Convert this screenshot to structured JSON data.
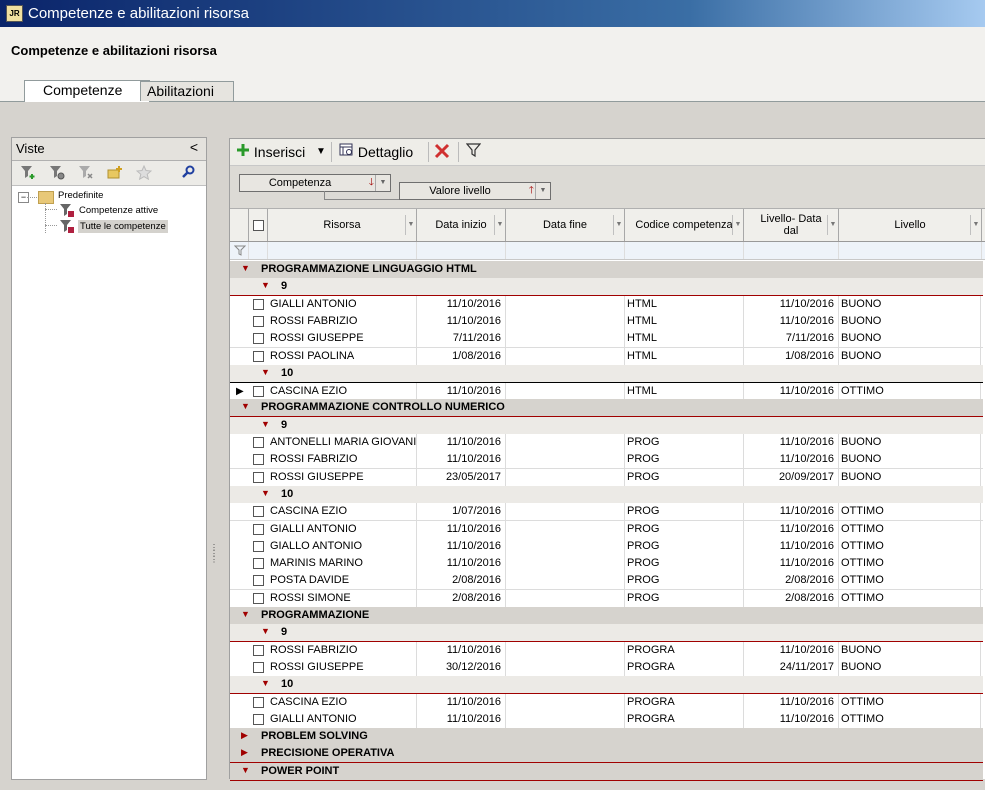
{
  "window": {
    "title": "Competenze e abilitazioni risorsa",
    "app_icon": "jr-app-icon"
  },
  "header": {
    "title": "Competenze e abilitazioni risorsa"
  },
  "tabs": [
    {
      "label": "Competenze",
      "active": true
    },
    {
      "label": "Abilitazioni",
      "active": false
    }
  ],
  "viste": {
    "title": "Viste",
    "collapse_glyph": "<",
    "tree": {
      "root": "Predefinite",
      "items": [
        "Competenze attive",
        "Tutte le competenze"
      ],
      "selected": "Tutte le competenze"
    }
  },
  "toolbar": {
    "insert_label": "Inserisci",
    "detail_label": "Dettaglio"
  },
  "grouping": {
    "level1": "Competenza",
    "level2": "Valore livello"
  },
  "columns": {
    "risorsa": "Risorsa",
    "data_inizio": "Data inizio",
    "data_fine": "Data fine",
    "codice": "Codice competenza",
    "livello_data": "Livello- Data dal",
    "livello": "Livello"
  },
  "groups": [
    {
      "name": "PROGRAMMAZIONE LINGUAGGIO HTML",
      "expanded": true,
      "subgroups": [
        {
          "value": "9",
          "rows": [
            [
              "GIALLI ANTONIO",
              "11/10/2016",
              "",
              "HTML",
              "11/10/2016",
              "BUONO"
            ],
            [
              "ROSSI FABRIZIO",
              "11/10/2016",
              "",
              "HTML",
              "11/10/2016",
              "BUONO"
            ],
            [
              "ROSSI GIUSEPPE",
              "7/11/2016",
              "",
              "HTML",
              "7/11/2016",
              "BUONO"
            ],
            [
              "ROSSI PAOLINA",
              "1/08/2016",
              "",
              "HTML",
              "1/08/2016",
              "BUONO"
            ]
          ]
        },
        {
          "value": "10",
          "rows": [
            [
              "CASCINA EZIO",
              "11/10/2016",
              "",
              "HTML",
              "11/10/2016",
              "OTTIMO"
            ]
          ]
        }
      ]
    },
    {
      "name": "PROGRAMMAZIONE CONTROLLO NUMERICO",
      "expanded": true,
      "subgroups": [
        {
          "value": "9",
          "rows": [
            [
              "ANTONELLI MARIA GIOVANI",
              "11/10/2016",
              "",
              "PROG",
              "11/10/2016",
              "BUONO"
            ],
            [
              "ROSSI FABRIZIO",
              "11/10/2016",
              "",
              "PROG",
              "11/10/2016",
              "BUONO"
            ],
            [
              "ROSSI GIUSEPPE",
              "23/05/2017",
              "",
              "PROG",
              "20/09/2017",
              "BUONO"
            ]
          ]
        },
        {
          "value": "10",
          "rows": [
            [
              "CASCINA EZIO",
              "1/07/2016",
              "",
              "PROG",
              "11/10/2016",
              "OTTIMO"
            ],
            [
              "GIALLI ANTONIO",
              "11/10/2016",
              "",
              "PROG",
              "11/10/2016",
              "OTTIMO"
            ],
            [
              "GIALLO ANTONIO",
              "11/10/2016",
              "",
              "PROG",
              "11/10/2016",
              "OTTIMO"
            ],
            [
              "MARINIS MARINO",
              "11/10/2016",
              "",
              "PROG",
              "11/10/2016",
              "OTTIMO"
            ],
            [
              "POSTA DAVIDE",
              "2/08/2016",
              "",
              "PROG",
              "2/08/2016",
              "OTTIMO"
            ],
            [
              "ROSSI SIMONE",
              "2/08/2016",
              "",
              "PROG",
              "2/08/2016",
              "OTTIMO"
            ]
          ]
        }
      ]
    },
    {
      "name": "PROGRAMMAZIONE",
      "expanded": true,
      "subgroups": [
        {
          "value": "9",
          "rows": [
            [
              "ROSSI FABRIZIO",
              "11/10/2016",
              "",
              "PROGRA",
              "11/10/2016",
              "BUONO"
            ],
            [
              "ROSSI GIUSEPPE",
              "30/12/2016",
              "",
              "PROGRA",
              "24/11/2017",
              "BUONO"
            ]
          ]
        },
        {
          "value": "10",
          "rows": [
            [
              "CASCINA EZIO",
              "11/10/2016",
              "",
              "PROGRA",
              "11/10/2016",
              "OTTIMO"
            ],
            [
              "GIALLI ANTONIO",
              "11/10/2016",
              "",
              "PROGRA",
              "11/10/2016",
              "OTTIMO"
            ]
          ]
        }
      ]
    },
    {
      "name": "PROBLEM SOLVING",
      "expanded": false,
      "subgroups": []
    },
    {
      "name": "PRECISIONE OPERATIVA",
      "expanded": false,
      "subgroups": []
    },
    {
      "name": "POWER POINT",
      "expanded": true,
      "subgroups": []
    }
  ],
  "current_row": "CASCINA EZIO",
  "colors": {
    "group_line": "#a00000",
    "title_bar": "#0a246a",
    "delete": "#d03030",
    "add": "#2a9a2a"
  }
}
